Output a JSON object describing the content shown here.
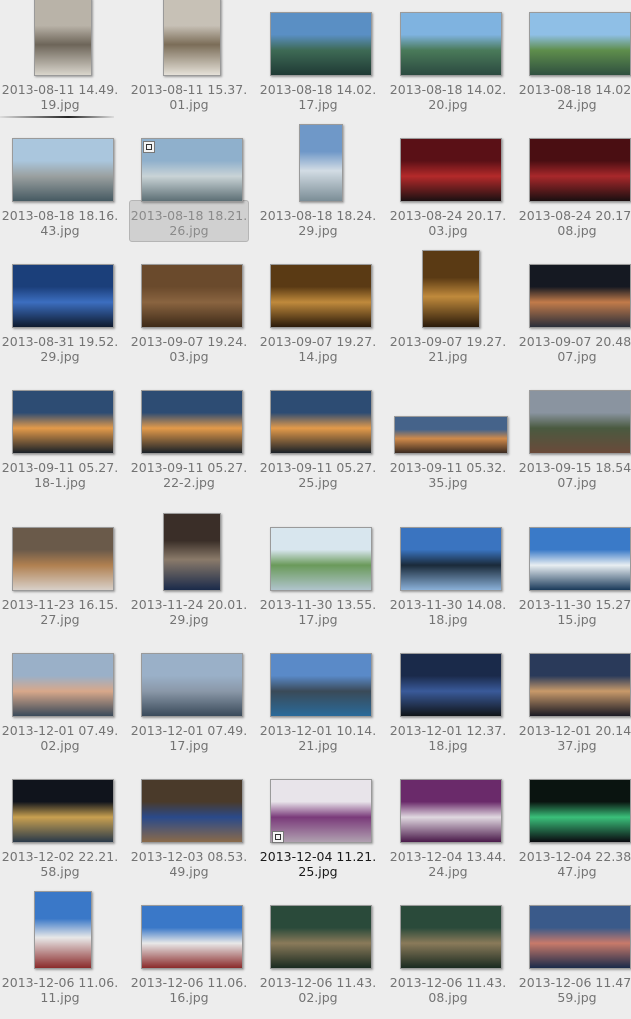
{
  "files": [
    {
      "line1": "2013-08-11 14.49.",
      "line2": "19.jpg",
      "orient": "portrait",
      "colors": [
        "#b9b3a8",
        "#6d6559",
        "#d9d5cc"
      ]
    },
    {
      "line1": "2013-08-11 15.37.",
      "line2": "01.jpg",
      "orient": "portrait",
      "colors": [
        "#c7c1b6",
        "#7b6d58",
        "#e5e1d8"
      ]
    },
    {
      "line1": "2013-08-18 14.02.",
      "line2": "17.jpg",
      "orient": "landscape",
      "colors": [
        "#5a8fc4",
        "#3e6a55",
        "#1f3a35"
      ]
    },
    {
      "line1": "2013-08-18 14.02.",
      "line2": "20.jpg",
      "orient": "landscape",
      "colors": [
        "#7fb3e0",
        "#4a7a5a",
        "#2b4a40"
      ]
    },
    {
      "line1": "2013-08-18 14.02.",
      "line2": "24.jpg",
      "orient": "landscape",
      "colors": [
        "#8fbfe6",
        "#5f8e4c",
        "#2f5040"
      ]
    },
    {
      "line1": "2013-08-18 18.16.",
      "line2": "43.jpg",
      "orient": "landscape",
      "colors": [
        "#aac6dd",
        "#9aa0a0",
        "#465a62"
      ]
    },
    {
      "line1": "2013-08-18 18.21.",
      "line2": "26.jpg",
      "orient": "landscape",
      "colors": [
        "#8fb0cc",
        "#c9d3d6",
        "#5d6f75"
      ]
    },
    {
      "line1": "2013-08-18 18.24.",
      "line2": "29.jpg",
      "orient": "portrait-small",
      "colors": [
        "#6f98c8",
        "#d2dce4",
        "#7b8d96"
      ]
    },
    {
      "line1": "2013-08-24 20.17.",
      "line2": "03.jpg",
      "orient": "landscape",
      "colors": [
        "#5a1016",
        "#b42a2a",
        "#1b1012"
      ]
    },
    {
      "line1": "2013-08-24 20.17.",
      "line2": "08.jpg",
      "orient": "landscape",
      "colors": [
        "#4a0e12",
        "#a8282b",
        "#1a0f10"
      ]
    },
    {
      "line1": "2013-08-31 19.52.",
      "line2": "29.jpg",
      "orient": "landscape",
      "colors": [
        "#1b3f7a",
        "#3c6ec0",
        "#0e1a2e"
      ]
    },
    {
      "line1": "2013-09-07 19.24.",
      "line2": "03.jpg",
      "orient": "landscape",
      "colors": [
        "#6a4a2c",
        "#8a6440",
        "#3d2a18"
      ]
    },
    {
      "line1": "2013-09-07 19.27.",
      "line2": "14.jpg",
      "orient": "landscape",
      "colors": [
        "#5a3a14",
        "#c08a3c",
        "#2a1a0a"
      ]
    },
    {
      "line1": "2013-09-07 19.27.",
      "line2": "21.jpg",
      "orient": "portrait-wide",
      "colors": [
        "#5a3a14",
        "#c08a3c",
        "#2a1a0a"
      ]
    },
    {
      "line1": "2013-09-07 20.48.",
      "line2": "07.jpg",
      "orient": "landscape",
      "colors": [
        "#151922",
        "#c27b4a",
        "#2a2e3a"
      ]
    },
    {
      "line1": "2013-09-11 05.27.",
      "line2": "18-1.jpg",
      "orient": "landscape",
      "colors": [
        "#2d4c73",
        "#e39a4a",
        "#1a2128"
      ]
    },
    {
      "line1": "2013-09-11 05.27.",
      "line2": "22-2.jpg",
      "orient": "landscape",
      "colors": [
        "#2d4c73",
        "#e39a4a",
        "#1a2128"
      ]
    },
    {
      "line1": "2013-09-11 05.27.",
      "line2": "25.jpg",
      "orient": "landscape",
      "colors": [
        "#2d4c73",
        "#e39a4a",
        "#1a2128"
      ]
    },
    {
      "line1": "2013-09-11 05.32.",
      "line2": "35.jpg",
      "orient": "panorama",
      "colors": [
        "#45638a",
        "#d08a4a",
        "#3a2a20"
      ]
    },
    {
      "line1": "2013-09-15 18.54.",
      "line2": "07.jpg",
      "orient": "landscape",
      "colors": [
        "#8a94a0",
        "#4a5a40",
        "#6a4a3a"
      ]
    },
    {
      "line1": "2013-11-23 16.15.",
      "line2": "27.jpg",
      "orient": "landscape",
      "colors": [
        "#6a5a4a",
        "#b08050",
        "#d8d0c8"
      ]
    },
    {
      "line1": "2013-11-24 20.01.",
      "line2": "29.jpg",
      "orient": "portrait",
      "colors": [
        "#3a2e28",
        "#8a7a6a",
        "#1a2a4a"
      ]
    },
    {
      "line1": "2013-11-30 13.55.",
      "line2": "17.jpg",
      "orient": "landscape",
      "colors": [
        "#d8e6ee",
        "#6a9a5a",
        "#b0c4cc"
      ]
    },
    {
      "line1": "2013-11-30 14.08.",
      "line2": "18.jpg",
      "orient": "landscape",
      "colors": [
        "#3a74c0",
        "#1a2a3a",
        "#8ab0d8"
      ]
    },
    {
      "line1": "2013-11-30 15.27.",
      "line2": "15.jpg",
      "orient": "landscape",
      "colors": [
        "#3a7ac8",
        "#e8eef2",
        "#1a3a5a"
      ]
    },
    {
      "line1": "2013-12-01 07.49.",
      "line2": "02.jpg",
      "orient": "landscape",
      "colors": [
        "#9ab0c8",
        "#d8a88a",
        "#3a4a5a"
      ]
    },
    {
      "line1": "2013-12-01 07.49.",
      "line2": "17.jpg",
      "orient": "landscape",
      "colors": [
        "#9ab0c8",
        "#8a98a8",
        "#3a4a5a"
      ]
    },
    {
      "line1": "2013-12-01 10.14.",
      "line2": "21.jpg",
      "orient": "landscape",
      "colors": [
        "#5a8ac8",
        "#3a4a58",
        "#2a6a9a"
      ]
    },
    {
      "line1": "2013-12-01 12.37.",
      "line2": "18.jpg",
      "orient": "landscape",
      "colors": [
        "#1a2a4a",
        "#3a5a9a",
        "#101418"
      ]
    },
    {
      "line1": "2013-12-01 20.14.",
      "line2": "37.jpg",
      "orient": "landscape",
      "colors": [
        "#2a3a5a",
        "#c89a6a",
        "#1a1a24"
      ]
    },
    {
      "line1": "2013-12-02 22.21.",
      "line2": "58.jpg",
      "orient": "landscape",
      "colors": [
        "#10141c",
        "#c8a050",
        "#2a3a4a"
      ]
    },
    {
      "line1": "2013-12-03 08.53.",
      "line2": "49.jpg",
      "orient": "landscape",
      "colors": [
        "#4a3a2a",
        "#2a4a8a",
        "#8a6a4a"
      ]
    },
    {
      "line1": "2013-12-04 11.21.",
      "line2": "25.jpg",
      "orient": "landscape",
      "colors": [
        "#e8e4ea",
        "#7a3a7a",
        "#b0a0b0"
      ]
    },
    {
      "line1": "2013-12-04 13.44.",
      "line2": "24.jpg",
      "orient": "landscape",
      "colors": [
        "#6a2a6a",
        "#e0d8e0",
        "#4a1a4a"
      ]
    },
    {
      "line1": "2013-12-04 22.38.",
      "line2": "47.jpg",
      "orient": "landscape",
      "colors": [
        "#0a1410",
        "#3ac07a",
        "#0a0a10"
      ]
    },
    {
      "line1": "2013-12-06 11.06.",
      "line2": "11.jpg",
      "orient": "portrait",
      "colors": [
        "#3a78c8",
        "#e8e8e8",
        "#8a2a2a"
      ]
    },
    {
      "line1": "2013-12-06 11.06.",
      "line2": "16.jpg",
      "orient": "landscape",
      "colors": [
        "#3a78c8",
        "#e8e8e8",
        "#8a2a2a"
      ]
    },
    {
      "line1": "2013-12-06 11.43.",
      "line2": "02.jpg",
      "orient": "landscape",
      "colors": [
        "#2a4a3a",
        "#8a7a5a",
        "#1a2a20"
      ]
    },
    {
      "line1": "2013-12-06 11.43.",
      "line2": "08.jpg",
      "orient": "landscape",
      "colors": [
        "#2a4a3a",
        "#8a7a5a",
        "#1a2a20"
      ]
    },
    {
      "line1": "2013-12-06 11.47.",
      "line2": "59.jpg",
      "orient": "landscape",
      "colors": [
        "#3a5a8a",
        "#c87a6a",
        "#1a2a4a"
      ]
    }
  ],
  "selected_index": 6,
  "focused_index": 32,
  "badge_indices": [
    6,
    32
  ]
}
